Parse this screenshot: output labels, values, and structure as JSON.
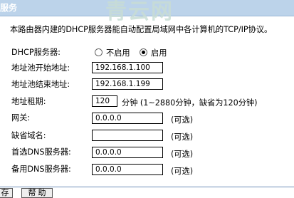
{
  "header": {
    "title": "服务"
  },
  "watermark": "青云网",
  "description": "本路由器内建的DHCP服务器能自动配置局域网中各计算机的TCP/IP协议。",
  "dhcp": {
    "label": "DHCP服务器:",
    "options": [
      {
        "label": "不启用",
        "selected": false
      },
      {
        "label": "启用",
        "selected": true
      }
    ]
  },
  "fields": {
    "pool_start": {
      "label": "地址池开始地址:",
      "value": "192.168.1.100"
    },
    "pool_end": {
      "label": "地址池结束地址:",
      "value": "192.168.1.199"
    },
    "lease": {
      "label": "地址租期:",
      "value": "120",
      "hint": "分钟 (1~2880分钟，缺省为120分钟)"
    },
    "gateway": {
      "label": "网关:",
      "value": "0.0.0.0",
      "hint": "(可选)"
    },
    "domain": {
      "label": "缺省域名:",
      "value": "",
      "hint": "(可选)"
    },
    "dns_primary": {
      "label": "首选DNS服务器:",
      "value": "0.0.0.0",
      "hint": "(可选)"
    },
    "dns_secondary": {
      "label": "备用DNS服务器:",
      "value": "0.0.0.0",
      "hint": "(可选)"
    }
  },
  "buttons": {
    "save": "存",
    "help": "帮 助"
  }
}
